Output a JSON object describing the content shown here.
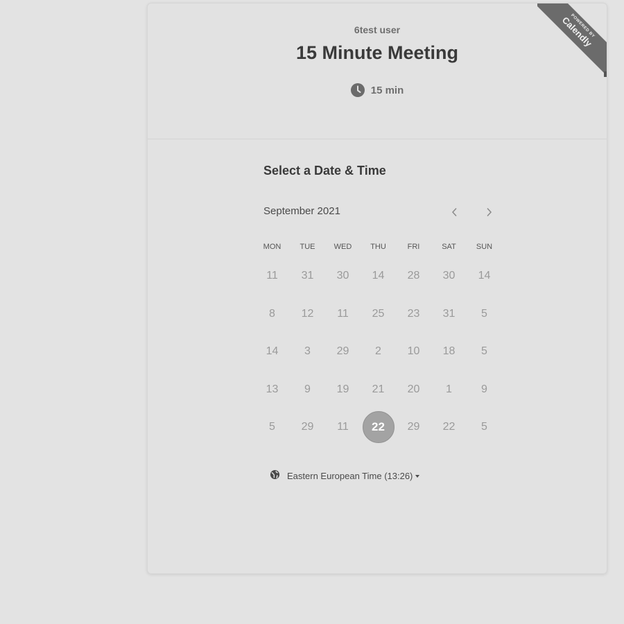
{
  "header": {
    "host_name": "6test user",
    "event_title": "15 Minute Meeting",
    "duration": "15 min"
  },
  "ribbon": {
    "powered_by": "POWERED BY",
    "brand": "Calendly"
  },
  "scheduler": {
    "section_title": "Select a Date & Time",
    "month_label": "September 2021",
    "weekdays": [
      "MON",
      "TUE",
      "WED",
      "THU",
      "FRI",
      "SAT",
      "SUN"
    ],
    "weeks": [
      [
        "11",
        "31",
        "30",
        "14",
        "28",
        "30",
        "14"
      ],
      [
        "8",
        "12",
        "11",
        "25",
        "23",
        "31",
        "5"
      ],
      [
        "14",
        "3",
        "29",
        "2",
        "10",
        "18",
        "5"
      ],
      [
        "13",
        "9",
        "19",
        "21",
        "20",
        "1",
        "9"
      ],
      [
        "5",
        "29",
        "11",
        "22",
        "29",
        "22",
        "5"
      ]
    ],
    "selected_day": "22",
    "timezone": "Eastern European Time (13:26)"
  },
  "icons": {
    "duration": "clock-icon",
    "timezone": "globe-icon",
    "prev": "chevron-left-icon",
    "next": "chevron-right-icon"
  },
  "colors": {
    "background": "#e3e3e3",
    "selected_day_bg": "#a3a3a3",
    "ribbon_bg": "#6b6b6b"
  }
}
